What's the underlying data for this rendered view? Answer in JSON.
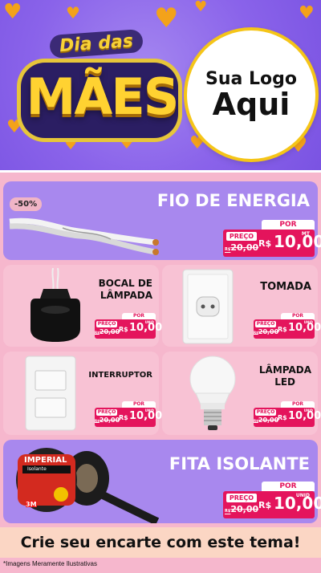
{
  "header": {
    "title_line1": "Dia das",
    "title_line2": "MÃES",
    "logo_line1": "Sua Logo",
    "logo_line2": "Aqui",
    "colors": {
      "purple": "#8a63ea",
      "gold": "#ffd231",
      "pink": "#e4145c"
    }
  },
  "products": [
    {
      "name": "FIO DE ENERGIA",
      "badge": "-50%",
      "por": "POR",
      "preco": "PREÇO",
      "old_prefix": "R$",
      "old_price": "20,00",
      "currency": "R$",
      "price": "10,00",
      "unit": "MT",
      "icon": "electric-wire-icon"
    },
    {
      "name_l1": "BOCAL DE",
      "name_l2": "LÂMPADA",
      "por": "POR",
      "preco": "PREÇO",
      "old_prefix": "R$",
      "old_price": "20,00",
      "currency": "R$",
      "price": "10,00",
      "unit": "UNID",
      "icon": "lamp-socket-icon"
    },
    {
      "name": "TOMADA",
      "por": "POR",
      "preco": "PREÇO",
      "old_prefix": "R$",
      "old_price": "20,00",
      "currency": "R$",
      "price": "10,00",
      "unit": "UNID",
      "icon": "power-outlet-icon"
    },
    {
      "name": "INTERRUPTOR",
      "por": "POR",
      "preco": "PREÇO",
      "old_prefix": "R$",
      "old_price": "20,00",
      "currency": "R$",
      "price": "10,00",
      "unit": "UNID",
      "icon": "light-switch-icon"
    },
    {
      "name_l1": "LÂMPADA",
      "name_l2": "LED",
      "por": "POR",
      "preco": "PREÇO",
      "old_prefix": "R$",
      "old_price": "20,00",
      "currency": "R$",
      "price": "10,00",
      "unit": "UNID",
      "icon": "led-bulb-icon"
    },
    {
      "name": "FITA ISOLANTE",
      "por": "POR",
      "preco": "PREÇO",
      "old_prefix": "R$",
      "old_price": "20,00",
      "currency": "R$",
      "price": "10,00",
      "unit": "UNID",
      "icon": "insulating-tape-icon",
      "tape_brand": "IMPERIAL",
      "tape_sub": "Isolante",
      "tape_mark": "3M"
    }
  ],
  "footer": {
    "cta": "Crie seu encarte com este tema!",
    "note": "*Imagens Meramente Ilustrativas"
  }
}
